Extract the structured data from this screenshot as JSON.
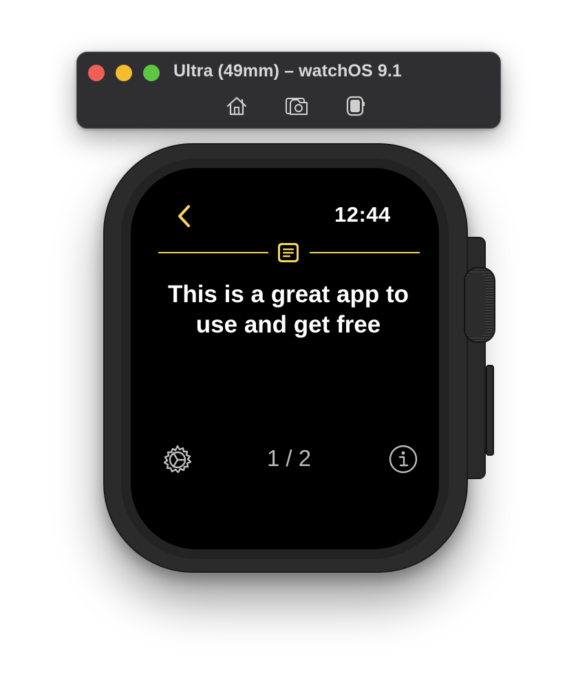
{
  "simulator": {
    "title": "Ultra (49mm) – watchOS 9.1",
    "controls": [
      {
        "name": "home",
        "icon": "home-icon"
      },
      {
        "name": "screenshot",
        "icon": "camera-icon"
      },
      {
        "name": "rotate",
        "icon": "rotate-device-icon"
      }
    ],
    "traffic_lights": {
      "close": "#ee5f57",
      "minimize": "#f4bc2e",
      "zoom": "#5ec641"
    }
  },
  "watch": {
    "time": "12:44",
    "back_icon": "chevron-left-icon",
    "header_icon": "note-icon",
    "message": "This is a great app to use and get free",
    "page_indicator": "1 / 2",
    "footer": {
      "settings_icon": "gear-icon",
      "info_icon": "info-icon"
    },
    "accent_color": "#f5d760",
    "screen_color": "#000000"
  }
}
